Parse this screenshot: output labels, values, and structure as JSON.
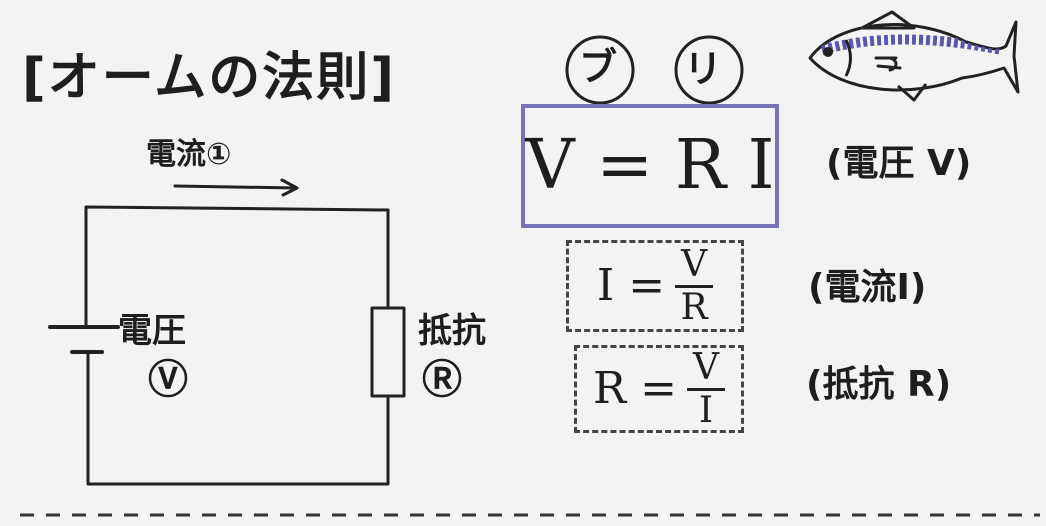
{
  "title": "[オームの法則]",
  "circuit": {
    "current_label": "電流①",
    "voltage_label": "電圧",
    "voltage_symbol": "Ⓥ",
    "resistance_label": "抵抗",
    "resistance_symbol": "Ⓡ"
  },
  "mnemonic": {
    "first": "ブ",
    "second": "リ",
    "fish_icon": "yellowtail-fish-icon"
  },
  "formulas": {
    "main": "V = R I",
    "current_lhs": "I =",
    "current_num": "V",
    "current_den": "R",
    "resistance_lhs": "R =",
    "resistance_num": "V",
    "resistance_den": "I"
  },
  "notes": {
    "voltage": "(電圧 V)",
    "current": "(電流I)",
    "resistance": "(抵抗 R)"
  },
  "colors": {
    "box_border": "#7872b6",
    "fish_stripe": "#5a55b0"
  }
}
